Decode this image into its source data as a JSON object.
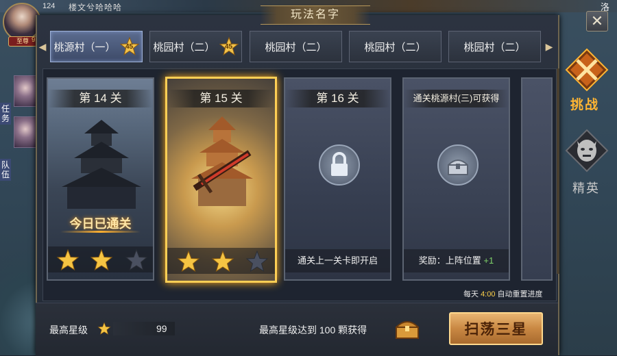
{
  "hud": {
    "top_level": "124",
    "top_name": "楼文兮哈哈哈",
    "vip_label": "至尊",
    "vip_level": "9",
    "corner_label": "洛",
    "side_tab_task": "任务",
    "side_tab_team": "队伍"
  },
  "dialog": {
    "title": "玩法名字",
    "close_label": "✕"
  },
  "tabs": [
    {
      "label": "桃源村（一）",
      "stars": "45",
      "active": true
    },
    {
      "label": "桃园村（二）",
      "stars": "45",
      "active": false
    },
    {
      "label": "桃园村（二）",
      "stars": "",
      "active": false
    },
    {
      "label": "桃园村（二）",
      "stars": "",
      "active": false
    },
    {
      "label": "桃园村（二）",
      "stars": "",
      "active": false
    }
  ],
  "tab_arrows": {
    "left": "◀",
    "right": "▶"
  },
  "side_menu": {
    "challenge_label": "挑战",
    "elite_label": "精英"
  },
  "stages": [
    {
      "title": "第 14 关",
      "status_text": "今日已通关",
      "stars_earned": 2,
      "stars_total": 3
    },
    {
      "title": "第 15 关",
      "status_text": "",
      "stars_earned": 2,
      "stars_total": 3,
      "selected": true
    },
    {
      "title": "第 16 关",
      "status_text": "通关上一关卡即开启",
      "locked": true
    },
    {
      "title": "通关桃源村(三)可获得",
      "reward_label": "奖励：上阵位置",
      "reward_value": "+1"
    }
  ],
  "footer": {
    "daily_prefix": "每天 ",
    "daily_time": "4:00",
    "daily_suffix": " 自动重置进度",
    "max_star_label": "最高星级",
    "max_star_value": "99",
    "reward_text": "最高星级达到 100 颗获得",
    "sweep_button": "扫荡三星"
  },
  "colors": {
    "accent_gold": "#ffcf55",
    "challenge_orange": "#ffb533",
    "reward_green": "#7fd36a",
    "sweep_button": "#c98843"
  }
}
